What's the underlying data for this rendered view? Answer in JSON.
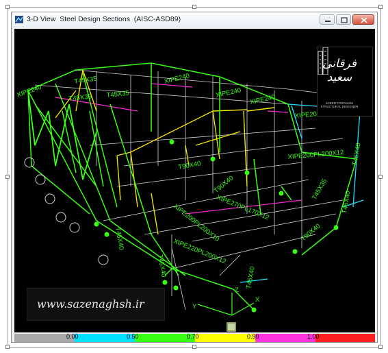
{
  "window": {
    "title": "3-D View  Steel Design Sections  (AISC-ASD89)"
  },
  "controls": {
    "minimize_icon": "minimize-icon",
    "maximize_icon": "maximize-icon",
    "close_icon": "close-icon"
  },
  "logo": {
    "name_line1": "فرقانی",
    "name_line2": "سعید",
    "tagline": "SAEED FORGHANI STRUCTURAL DESIGNER"
  },
  "watermark": {
    "text": "www.sazenaghsh.ir"
  },
  "model": {
    "section_labels": [
      "T45X35",
      "T45X35",
      "XIPE240",
      "XIPE240",
      "XIPE240",
      "XIPE200PL200X10",
      "XIPE200PL200X12",
      "XIPE200PL200X10",
      "XIPE270PL170X12",
      "XIPE220PL200X12",
      "T90X40",
      "T90X40",
      "T90X40",
      "T45X40",
      "T45X40",
      "T45X40",
      "T45X40",
      "T45X35",
      "T45X35",
      "XIPE240",
      "T45X40"
    ],
    "axes": {
      "x": "X",
      "y": "Y",
      "z": "Z"
    }
  },
  "colors": {
    "background": "#000000",
    "frame_green": "#39ff14",
    "frame_yellow": "#f2e600",
    "frame_white": "#d8d8d8",
    "frame_magenta": "#ff2bd6",
    "frame_cyan": "#22e0ff"
  },
  "legend": {
    "segments": [
      {
        "color": "#a9a9a9",
        "label": "0.00"
      },
      {
        "color": "#00e0ff",
        "label": "0.50"
      },
      {
        "color": "#39ff14",
        "label": "0.70"
      },
      {
        "color": "#ffff00",
        "label": "0.90"
      },
      {
        "color": "#ff33dd",
        "label": "1.00"
      },
      {
        "color": "#ff2020",
        "label": ""
      }
    ]
  }
}
